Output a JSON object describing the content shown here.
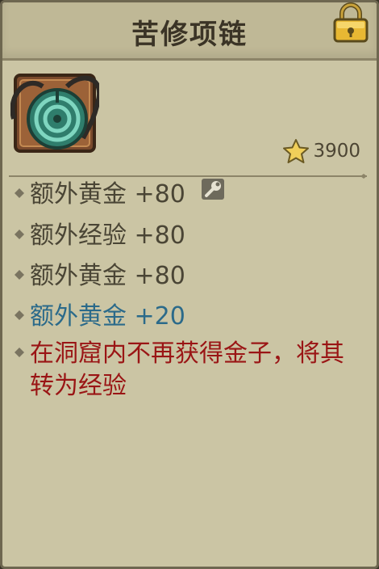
{
  "item": {
    "name": "苦修项链",
    "cost": "3900",
    "icon": "jade-necklace-icon"
  },
  "stats": [
    {
      "text": "额外黄金 +80",
      "color": "#4a4535",
      "has_upgrade_icon": true
    },
    {
      "text": "额外经验 +80",
      "color": "#4a4535"
    },
    {
      "text": "额外黄金 +80",
      "color": "#4a4535"
    },
    {
      "text": "额外黄金 +20",
      "color": "#2b6a8a"
    },
    {
      "text": "在洞窟内不再获得金子，将其转为经验",
      "color": "#9a1515"
    }
  ],
  "icons": {
    "lock": "padlock-icon",
    "star": "star-icon",
    "upgrade": "wrench-icon",
    "bullet": "diamond-bullet-icon"
  }
}
